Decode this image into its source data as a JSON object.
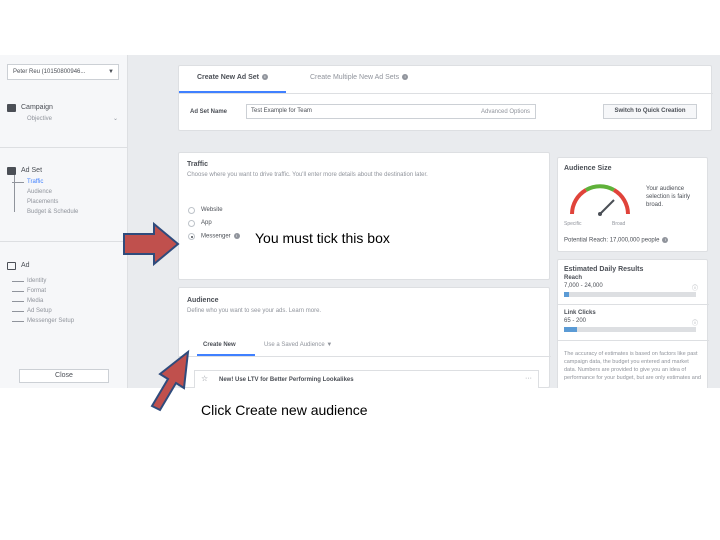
{
  "left_nav": {
    "account": "Peter Reu (10150800946...",
    "campaign": {
      "label": "Campaign",
      "items": [
        "Objective"
      ]
    },
    "ad_set": {
      "label": "Ad Set",
      "items": [
        "Traffic",
        "Audience",
        "Placements",
        "Budget & Schedule"
      ]
    },
    "ad": {
      "label": "Ad",
      "items": [
        "Identity",
        "Format",
        "Media",
        "Ad Setup",
        "Messenger Setup"
      ]
    },
    "close_label": "Close"
  },
  "tabs": {
    "create_new": "Create New Ad Set",
    "create_multiple": "Create Multiple New Ad Sets"
  },
  "ad_set_name": {
    "label": "Ad Set Name",
    "value": "Test Example for Team",
    "advanced": "Advanced Options",
    "quick_button": "Switch to Quick Creation"
  },
  "traffic": {
    "title": "Traffic",
    "description": "Choose where you want to drive traffic. You'll enter more details about the destination later.",
    "options": [
      "Website",
      "App",
      "Messenger"
    ],
    "selected": "Messenger"
  },
  "audience": {
    "title": "Audience",
    "description": "Define who you want to see your ads. Learn more.",
    "tab_create": "Create New",
    "tab_saved": "Use a Saved Audience",
    "lookalike_text": "New! Use LTV for Better Performing Lookalikes"
  },
  "audience_size": {
    "title": "Audience Size",
    "specific": "Specific",
    "broad": "Broad",
    "description": "Your audience selection is fairly broad.",
    "reach_label": "Potential Reach:",
    "reach_value": "17,000,000 people"
  },
  "daily_results": {
    "title": "Estimated Daily Results",
    "reach_label": "Reach",
    "reach_value": "7,000 - 24,000",
    "reach_fill": 0.04,
    "clicks_label": "Link Clicks",
    "clicks_value": "65 - 200",
    "clicks_fill": 0.1,
    "accuracy": "The accuracy of estimates is based on factors like past campaign data, the budget you entered and market data. Numbers are provided to give you an idea of performance for your budget, but are only estimates and"
  },
  "annotations": {
    "tick": "You must tick this box",
    "create": "Click Create new audience"
  },
  "colors": {
    "accent": "#4080ff",
    "arrow_fill": "#c0504d",
    "arrow_stroke": "#2f4b7c"
  }
}
